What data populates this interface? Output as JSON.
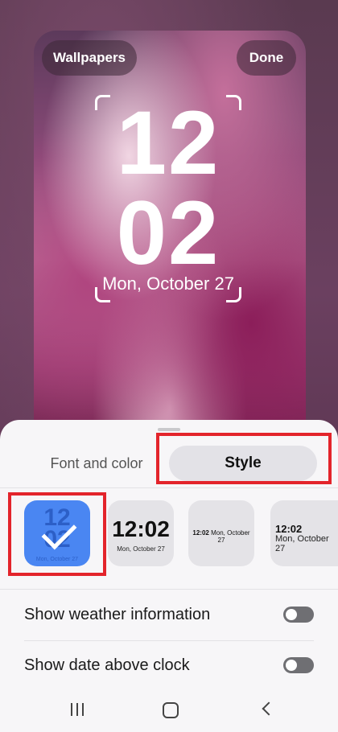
{
  "preview": {
    "wallpapers_label": "Wallpapers",
    "done_label": "Done",
    "clock_hours": "12",
    "clock_minutes": "02",
    "clock_date": "Mon, October 27"
  },
  "tabs": {
    "font_and_color": "Font and color",
    "style": "Style",
    "active": "Style"
  },
  "clock_styles": [
    {
      "digits_top": "12",
      "digits_bottom": "02",
      "date": "Mon, October 27",
      "selected": true
    },
    {
      "time": "12:02",
      "date": "Mon, October 27",
      "selected": false
    },
    {
      "time": "12:02",
      "date": "Mon, October 27",
      "selected": false
    },
    {
      "time": "12:02",
      "date": "Mon, October 27",
      "selected": false
    }
  ],
  "settings": [
    {
      "label": "Show weather information",
      "enabled": false
    },
    {
      "label": "Show date above clock",
      "enabled": false
    }
  ],
  "colors": {
    "highlight": "#e3242b",
    "selected_card": "#4a86f2",
    "toggle_off": "#6f6f73"
  },
  "navbar": {
    "recent_icon": "recents-icon",
    "home_icon": "home-icon",
    "back_icon": "back-icon"
  }
}
